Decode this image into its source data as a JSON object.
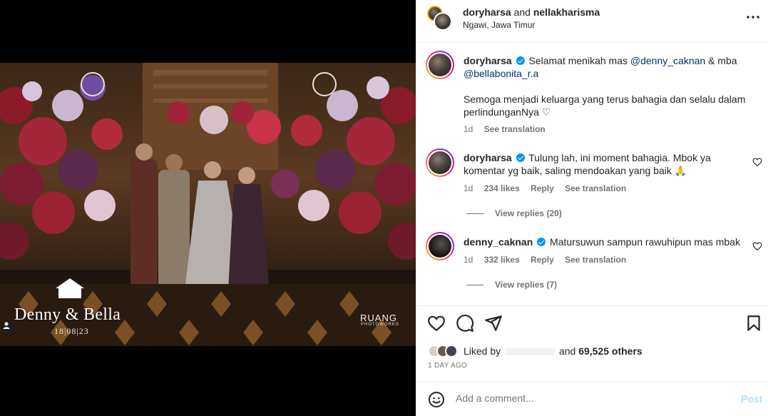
{
  "media": {
    "watermark_title": "Denny & Bella",
    "watermark_date": "18|08|23",
    "brand": "RUANG",
    "brand_sub": "PHOTOWORKS"
  },
  "header": {
    "user1": "doryharsa",
    "and": "and",
    "user2": "nellakharisma",
    "location": "Ngawi, Jawa Timur"
  },
  "caption": {
    "user": "doryharsa",
    "text_a": "Selamat menikah mas ",
    "mention1": "@denny_caknan",
    "text_b": " & mba ",
    "mention2": "@bellabonita_r.a",
    "text_c": "Semoga menjadi keluarga yang terus bahagia dan selalu dalam perlindunganNya ♡",
    "age": "1d",
    "see_translation": "See translation"
  },
  "comments": [
    {
      "user": "doryharsa",
      "text": "Tulung lah, ini moment bahagia. Mbok ya komentar yg baik, saling mendoakan yang baik 🙏",
      "age": "1d",
      "likes": "234 likes",
      "reply": "Reply",
      "see_translation": "See translation",
      "view_replies": "View replies (20)"
    },
    {
      "user": "denny_caknan",
      "text": "Matursuwun sampun rawuhipun mas mbak",
      "age": "1d",
      "likes": "332 likes",
      "reply": "Reply",
      "see_translation": "See translation",
      "view_replies": "View replies (7)"
    }
  ],
  "likes": {
    "prefix": "Liked by",
    "suffix": "and",
    "others": "69,525 others"
  },
  "time": "1 DAY AGO",
  "add_comment": {
    "placeholder": "Add a comment...",
    "post": "Post"
  },
  "colors": {
    "link": "#00376b",
    "verified": "#0095f6",
    "post_disabled": "#b2dffc"
  },
  "icons": [
    "more-icon",
    "heart-icon",
    "comment-icon",
    "share-icon",
    "bookmark-icon",
    "emoji-icon",
    "user-tag-icon",
    "verified-icon"
  ]
}
